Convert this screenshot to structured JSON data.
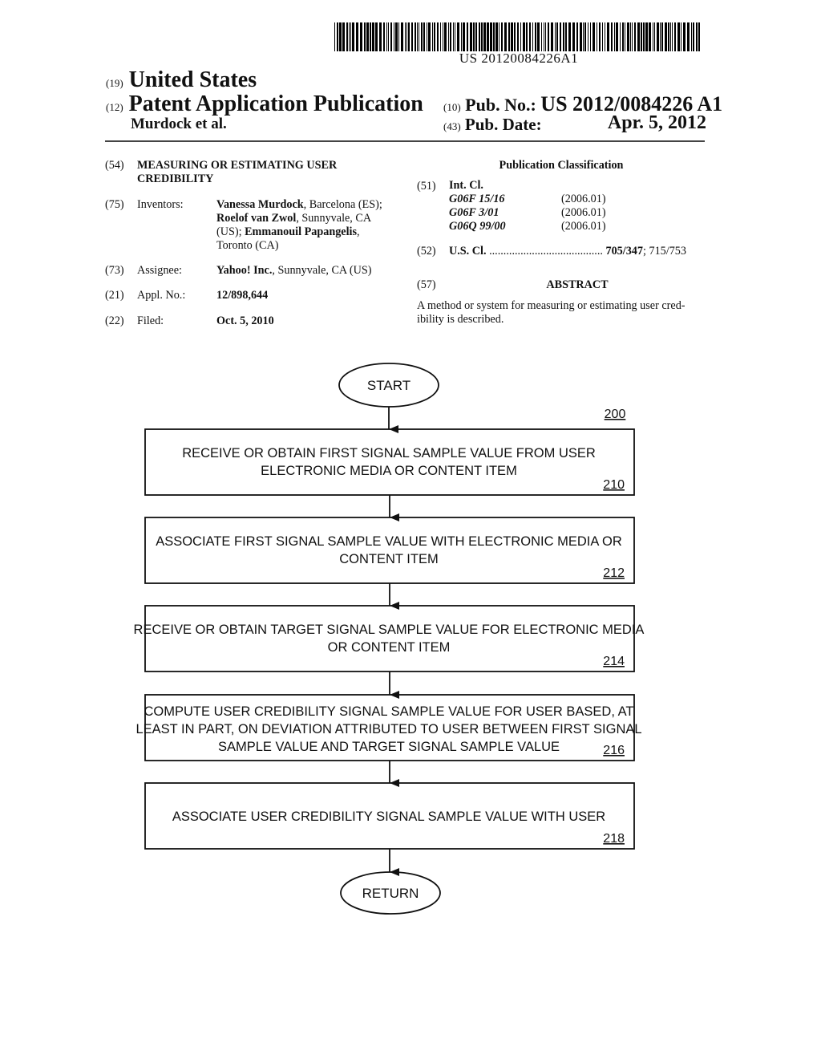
{
  "barcode": {
    "number": "US 20120084226A1"
  },
  "header": {
    "country_code": "(19)",
    "country": "United States",
    "type_code": "(12)",
    "type": "Patent Application Publication",
    "authors": "Murdock et al.",
    "pub_no_code": "(10)",
    "pub_no_label": "Pub. No.:",
    "pub_no": "US 2012/0084226 A1",
    "pub_date_code": "(43)",
    "pub_date_label": "Pub. Date:",
    "pub_date": "Apr. 5, 2012"
  },
  "biblio": {
    "title_code": "(54)",
    "title_line1": "MEASURING OR ESTIMATING USER",
    "title_line2": "CREDIBILITY",
    "inventors_code": "(75)",
    "inventors_label": "Inventors:",
    "inventors": [
      {
        "name": "Vanessa Murdock",
        "loc": ", Barcelona (ES);"
      },
      {
        "name": "Roelof van Zwol",
        "loc": ", Sunnyvale, CA"
      },
      {
        "pre": "(US); ",
        "name": "Emmanouil Papangelis",
        "loc": ","
      },
      {
        "loc": "Toronto (CA)"
      }
    ],
    "assignee_code": "(73)",
    "assignee_label": "Assignee:",
    "assignee_name": "Yahoo! Inc.",
    "assignee_loc": ", Sunnyvale, CA (US)",
    "appl_code": "(21)",
    "appl_label": "Appl. No.:",
    "appl_no": "12/898,644",
    "filed_code": "(22)",
    "filed_label": "Filed:",
    "filed_date": "Oct. 5, 2010"
  },
  "classification": {
    "heading": "Publication Classification",
    "int_code": "(51)",
    "int_label": "Int. Cl.",
    "int_classes": [
      {
        "cls": "G06F 15/16",
        "ver": "(2006.01)"
      },
      {
        "cls": "G06F 3/01",
        "ver": "(2006.01)"
      },
      {
        "cls": "G06Q 99/00",
        "ver": "(2006.01)"
      }
    ],
    "us_code": "(52)",
    "us_label": "U.S. Cl.",
    "us_dots": "........................................",
    "us_primary": "705/347",
    "us_secondary": "; 715/753"
  },
  "abstract": {
    "code": "(57)",
    "heading": "ABSTRACT",
    "line1": "A method or system for measuring or estimating user cred-",
    "line2": "ibility is described."
  },
  "flowchart": {
    "figure_ref": "200",
    "start": "START",
    "end": "RETURN",
    "steps": [
      {
        "ref": "210",
        "lines": [
          "RECEIVE OR OBTAIN FIRST SIGNAL SAMPLE VALUE FROM USER",
          "ELECTRONIC MEDIA OR CONTENT ITEM"
        ]
      },
      {
        "ref": "212",
        "lines": [
          "ASSOCIATE FIRST SIGNAL SAMPLE VALUE WITH ELECTRONIC MEDIA OR",
          "CONTENT ITEM"
        ]
      },
      {
        "ref": "214",
        "lines": [
          "RECEIVE OR OBTAIN TARGET SIGNAL SAMPLE VALUE FOR ELECTRONIC MEDIA",
          "OR CONTENT ITEM"
        ]
      },
      {
        "ref": "216",
        "lines": [
          "COMPUTE USER CREDIBILITY SIGNAL SAMPLE VALUE FOR USER BASED, AT",
          "LEAST IN PART, ON DEVIATION ATTRIBUTED TO USER  BETWEEN FIRST SIGNAL",
          "SAMPLE VALUE AND TARGET SIGNAL SAMPLE VALUE"
        ]
      },
      {
        "ref": "218",
        "lines": [
          "ASSOCIATE USER CREDIBILITY SIGNAL SAMPLE VALUE WITH USER"
        ]
      }
    ]
  }
}
